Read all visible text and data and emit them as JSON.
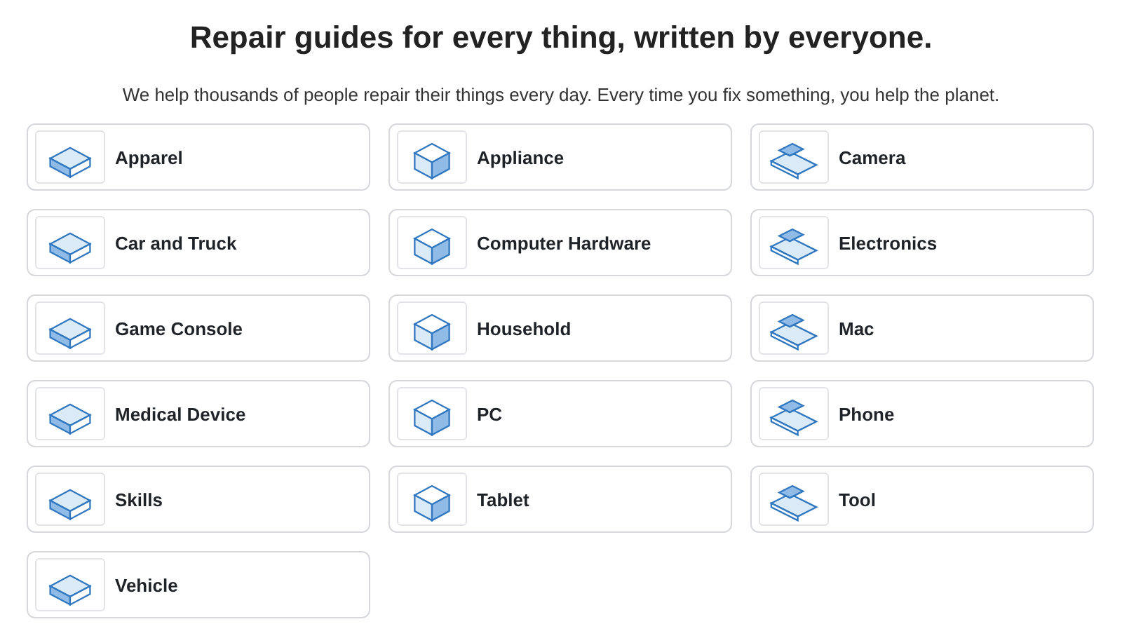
{
  "heading": "Repair guides for every thing, written by everyone.",
  "subheading": "We help thousands of people repair their things every day. Every time you fix something, you help the planet.",
  "categories": [
    {
      "label": "Apparel"
    },
    {
      "label": "Appliance"
    },
    {
      "label": "Camera"
    },
    {
      "label": "Car and Truck"
    },
    {
      "label": "Computer Hardware"
    },
    {
      "label": "Electronics"
    },
    {
      "label": "Game Console"
    },
    {
      "label": "Household"
    },
    {
      "label": "Mac"
    },
    {
      "label": "Medical Device"
    },
    {
      "label": "PC"
    },
    {
      "label": "Phone"
    },
    {
      "label": "Skills"
    },
    {
      "label": "Tablet"
    },
    {
      "label": "Tool"
    },
    {
      "label": "Vehicle"
    }
  ]
}
